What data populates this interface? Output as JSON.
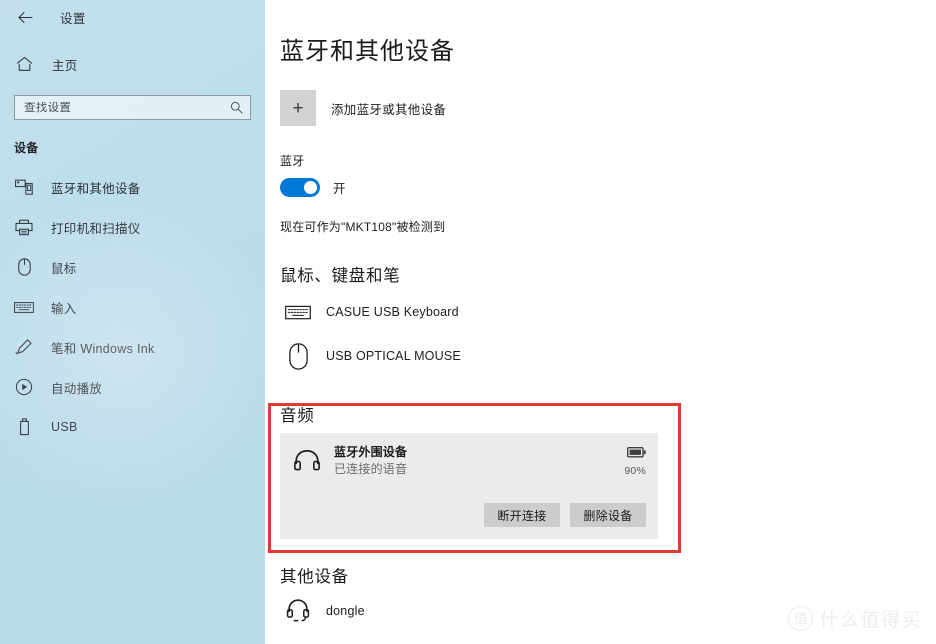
{
  "window": {
    "back_icon": "back-arrow-icon",
    "title": "设置"
  },
  "sidebar": {
    "home": {
      "label": "主页",
      "icon": "home-icon"
    },
    "search": {
      "placeholder": "查找设置",
      "value": "",
      "icon": "search-icon"
    },
    "group_heading": "设备",
    "items": [
      {
        "label": "蓝牙和其他设备",
        "icon": "bluetooth-device-icon",
        "selected": true
      },
      {
        "label": "打印机和扫描仪",
        "icon": "printer-icon",
        "selected": false
      },
      {
        "label": "鼠标",
        "icon": "mouse-icon",
        "selected": false
      },
      {
        "label": "输入",
        "icon": "keyboard-icon",
        "selected": false
      },
      {
        "label": "笔和 Windows Ink",
        "icon": "pen-icon",
        "selected": false
      },
      {
        "label": "自动播放",
        "icon": "autoplay-icon",
        "selected": false
      },
      {
        "label": "USB",
        "icon": "usb-icon",
        "selected": false
      }
    ]
  },
  "main": {
    "page_title": "蓝牙和其他设备",
    "add_device": {
      "label": "添加蓝牙或其他设备",
      "icon": "plus-icon"
    },
    "bluetooth": {
      "label": "蓝牙",
      "toggle_state": "开",
      "toggle_on": true,
      "discoverable_text": "现在可作为\"MKT108\"被检测到"
    },
    "sections": [
      {
        "heading": "鼠标、键盘和笔",
        "devices": [
          {
            "name": "CASUE USB Keyboard",
            "icon": "keyboard-device-icon"
          },
          {
            "name": "USB OPTICAL MOUSE",
            "icon": "mouse-device-icon"
          }
        ]
      }
    ],
    "audio": {
      "heading": "音频",
      "device": {
        "name": "蓝牙外围设备",
        "status": "已连接的语音",
        "icon": "headphones-icon",
        "battery_icon": "battery-icon",
        "battery_percent": "90%"
      },
      "buttons": {
        "disconnect": "断开连接",
        "remove": "删除设备"
      }
    },
    "other": {
      "heading": "其他设备",
      "devices": [
        {
          "name": "dongle",
          "icon": "headset-icon"
        }
      ]
    }
  },
  "annotation": {
    "highlight_color": "#e03a34"
  },
  "watermark": {
    "badge": "值",
    "text": "什么值得买"
  }
}
